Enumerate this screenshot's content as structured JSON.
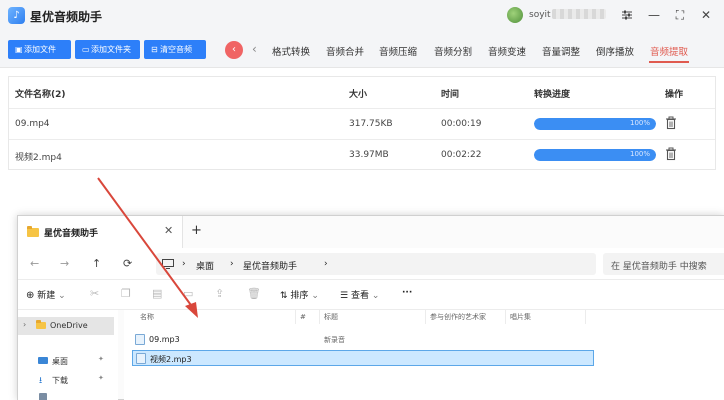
{
  "app": {
    "title": "星优音频助手",
    "logo_glyph": "♪",
    "username": "soyit"
  },
  "window_controls": {
    "settings_icon": "sliders-icon",
    "minimize": "—",
    "maximize": "⛶",
    "close": "✕"
  },
  "toolbar": {
    "add_file": "添加文件",
    "add_folder": "添加文件夹",
    "clear_audio": "清空音频",
    "back_glyph": "‹"
  },
  "tabs": {
    "prev_arrow": "‹",
    "items": [
      "格式转换",
      "音频合并",
      "音频压缩",
      "音频分割",
      "音频变速",
      "音量调整",
      "倒序播放",
      "音频提取"
    ],
    "active_index": 7,
    "active_color": "#e05a4f"
  },
  "table": {
    "headers": {
      "name": "文件名称(2)",
      "size": "大小",
      "time": "时间",
      "progress": "转换进度",
      "action": "操作"
    },
    "rows": [
      {
        "name": "09.mp4",
        "size": "317.75KB",
        "time": "00:00:19",
        "progress": 100,
        "progress_label": "100%"
      },
      {
        "name": "视频2.mp4",
        "size": "33.97MB",
        "time": "00:02:22",
        "progress": 100,
        "progress_label": "100%"
      }
    ]
  },
  "explorer": {
    "tab_title": "星优音频助手",
    "tab_close": "✕",
    "new_tab": "+",
    "nav": {
      "back": "←",
      "forward": "→",
      "up": "↑",
      "refresh": "⟳",
      "expand": "›"
    },
    "address": {
      "crumb1": "桌面",
      "sep": "›",
      "crumb2": "星优音频助手",
      "more": "›"
    },
    "search_placeholder": "在 星优音频助手 中搜索",
    "commands": {
      "new": "新建",
      "new_caret": "⌄",
      "sort": "排序",
      "sort_caret": "⌄",
      "view": "查看",
      "view_caret": "⌄",
      "more": "···"
    },
    "sidebar": [
      {
        "label": "OneDrive",
        "expander": "›",
        "selected": true
      },
      {
        "label": "桌面",
        "pin": "📌"
      },
      {
        "label": "下载",
        "pin": "📌"
      }
    ],
    "columns": {
      "name": "名称",
      "number": "#",
      "title": "标题",
      "artist": "参与创作的艺术家",
      "album": "唱片集"
    },
    "files": [
      {
        "name": "09.mp3",
        "title": "新录音",
        "selected": false
      },
      {
        "name": "视频2.mp3",
        "title": "",
        "selected": true
      }
    ]
  },
  "colors": {
    "primary_button": "#2d7ff9",
    "progress_fill": "#3b8ef3",
    "annotation_arrow": "#d9473b",
    "back_circle": "#f06464"
  }
}
